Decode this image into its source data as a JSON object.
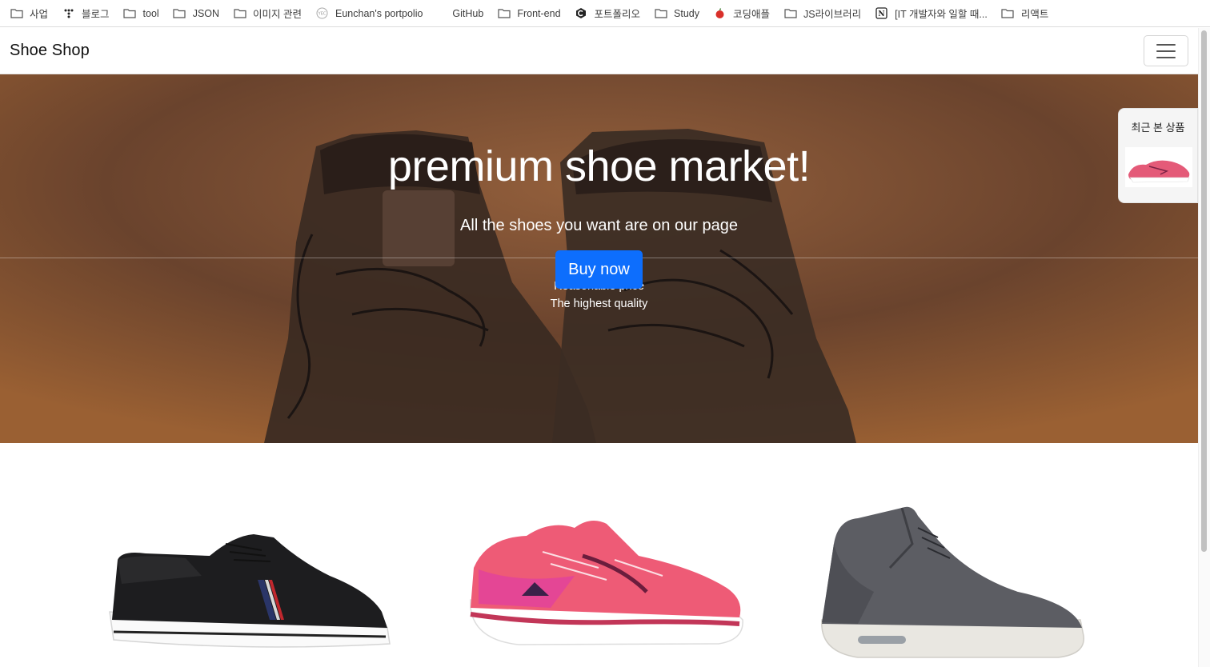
{
  "bookmarks": [
    {
      "label": "사업",
      "icon": "folder-icon"
    },
    {
      "label": "블로그",
      "icon": "tistory-icon"
    },
    {
      "label": "tool",
      "icon": "folder-icon"
    },
    {
      "label": "JSON",
      "icon": "folder-icon"
    },
    {
      "label": "이미지 관련",
      "icon": "folder-icon"
    },
    {
      "label": "Eunchan's portpolio",
      "icon": "site-logo-icon"
    },
    {
      "label": "GitHub",
      "icon": "none"
    },
    {
      "label": "Front-end",
      "icon": "folder-icon"
    },
    {
      "label": "포트폴리오",
      "icon": "hexagon-logo-icon"
    },
    {
      "label": "Study",
      "icon": "folder-icon"
    },
    {
      "label": "코딩애플",
      "icon": "apple-icon"
    },
    {
      "label": "JS라이브러리",
      "icon": "folder-icon"
    },
    {
      "label": "[IT 개발자와 일할 때...",
      "icon": "notion-icon"
    },
    {
      "label": "리액트",
      "icon": "folder-icon"
    }
  ],
  "navbar": {
    "brand": "Shoe Shop",
    "toggler_icon": "hamburger-icon"
  },
  "hero": {
    "title": "premium shoe market!",
    "subtitle": "All the shoes you want are on our page",
    "line1": "Reasonable price",
    "line2": "The highest quality",
    "button": "Buy now"
  },
  "recent": {
    "title": "최근 본 상품"
  },
  "colors": {
    "primary": "#0d6efd",
    "hero_bg": "#6e4630"
  },
  "products": [
    {
      "name": "black-canvas-sneaker"
    },
    {
      "name": "pink-running-shoe"
    },
    {
      "name": "grey-wool-high-top"
    }
  ]
}
